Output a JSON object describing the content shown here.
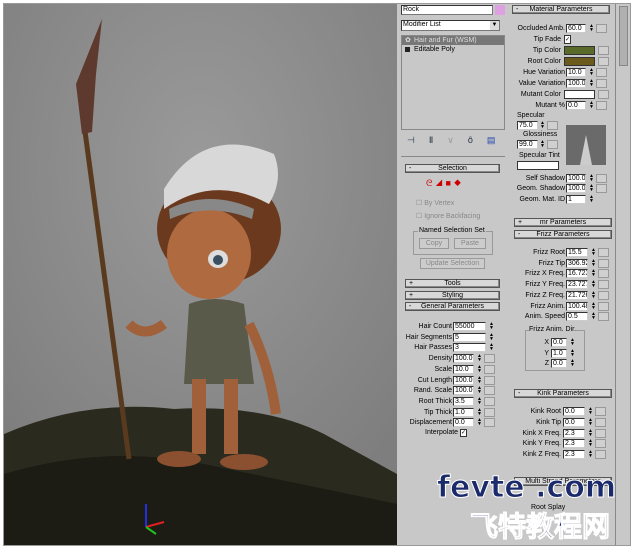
{
  "object_name": "Rock",
  "object_color": "#dda0e0",
  "modifier_list": {
    "label": "Modifier List",
    "stack": [
      {
        "label": "Hair and Fur (WSM)",
        "selected": true
      },
      {
        "label": "Editable Poly",
        "selected": false
      }
    ]
  },
  "selection": {
    "title": "Selection",
    "by_vertex": "By Vertex",
    "ignore_backfacing": "Ignore Backfacing",
    "named_set": "Named Selection Set",
    "copy": "Copy",
    "paste": "Paste",
    "update": "Update Selection"
  },
  "rollouts": {
    "tools": "Tools",
    "styling": "Styling",
    "general": "General Parameters",
    "mr": "mr Parameters",
    "frizz": "Frizz Parameters",
    "kink": "Kink Parameters",
    "multi": "Multi Strand Parameters",
    "material": "Material Parameters"
  },
  "general": [
    {
      "label": "Hair Count",
      "value": "55000"
    },
    {
      "label": "Hair Segments",
      "value": "5"
    },
    {
      "label": "Hair Passes",
      "value": "3"
    },
    {
      "label": "Density",
      "value": "100.0"
    },
    {
      "label": "Scale",
      "value": "10.0"
    },
    {
      "label": "Cut Length",
      "value": "100.0"
    },
    {
      "label": "Rand. Scale",
      "value": "100.0"
    },
    {
      "label": "Root Thick",
      "value": "3.5"
    },
    {
      "label": "Tip Thick",
      "value": "1.0"
    },
    {
      "label": "Displacement",
      "value": "0.0"
    }
  ],
  "interpolate": "Interpolate",
  "material": {
    "occluded": {
      "label": "Occluded Amb.",
      "value": "60.0"
    },
    "tip_fade": "Tip Fade",
    "tip_color": {
      "label": "Tip Color",
      "color": "#5a6a2a"
    },
    "root_color": {
      "label": "Root Color",
      "color": "#6a5a1c"
    },
    "hue": {
      "label": "Hue Variation",
      "value": "10.0"
    },
    "valuevar": {
      "label": "Value Variation",
      "value": "100.0"
    },
    "mutant_color": {
      "label": "Mutant Color",
      "color": "#ffffff"
    },
    "mutant_pct": {
      "label": "Mutant %",
      "value": "0.0"
    },
    "specular": {
      "label": "Specular",
      "value": "75.0"
    },
    "gloss": {
      "label": "Glossiness",
      "value": "99.0"
    },
    "spec_tint": "Specular Tint",
    "self_shadow": {
      "label": "Self Shadow",
      "value": "100.0"
    },
    "geom_shadow": {
      "label": "Geom. Shadow",
      "value": "100.0"
    },
    "geom_mat": {
      "label": "Geom. Mat. ID",
      "value": "1"
    }
  },
  "frizz": [
    {
      "label": "Frizz Root",
      "value": "15.5"
    },
    {
      "label": "Frizz Tip",
      "value": "306.92"
    },
    {
      "label": "Frizz X Freq.",
      "value": "16.723"
    },
    {
      "label": "Frizz Y Freq.",
      "value": "23.727"
    },
    {
      "label": "Frizz Z Freq.",
      "value": "21.726"
    },
    {
      "label": "Frizz Anim.",
      "value": "100.48"
    },
    {
      "label": "Anim. Speed",
      "value": "0.5"
    }
  ],
  "frizz_dir": {
    "title": "Frizz Anim. Dir.",
    "axes": [
      {
        "label": "X",
        "value": "0.0"
      },
      {
        "label": "Y",
        "value": "1.0"
      },
      {
        "label": "Z",
        "value": "0.0"
      }
    ]
  },
  "kink": [
    {
      "label": "Kink Root",
      "value": "0.0"
    },
    {
      "label": "Kink Tip",
      "value": "0.0"
    },
    {
      "label": "Kink X Freq.",
      "value": "2.3"
    },
    {
      "label": "Kink Y Freq.",
      "value": "2.3"
    },
    {
      "label": "Kink Z Freq.",
      "value": "2.3"
    }
  ],
  "multi_partial": "Root Splay",
  "watermark": {
    "line1": "fevte .com",
    "line2": "飞特教程网"
  }
}
